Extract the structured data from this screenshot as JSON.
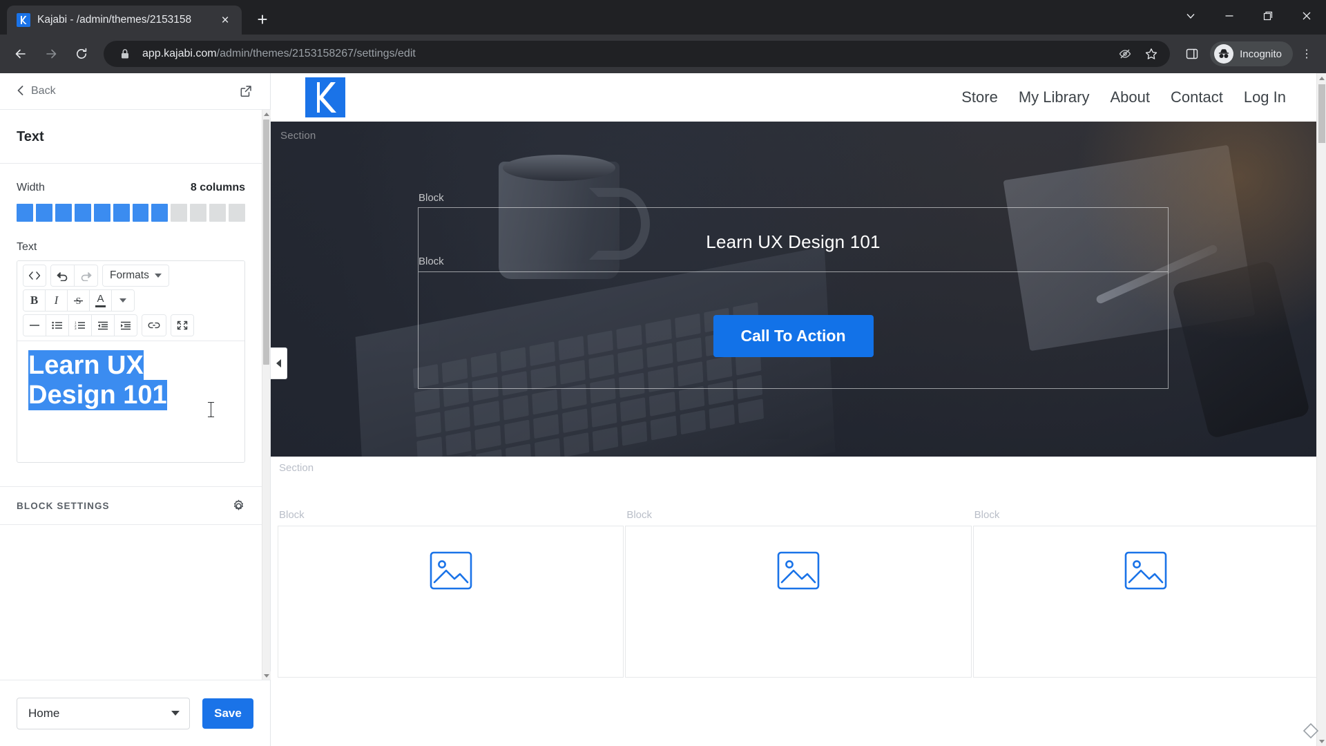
{
  "browser": {
    "tab": {
      "title": "Kajabi - /admin/themes/2153158",
      "favicon_name": "kajabi-favicon",
      "close_label": "×"
    },
    "new_tab_label": "+",
    "window_controls": {
      "chevron_label": "⌄",
      "minimize_label": "—",
      "restore_label": "❐",
      "close_label": "✕"
    },
    "nav": {
      "back_label": "←",
      "forward_label": "→",
      "reload_label": "↻"
    },
    "address": {
      "lock_icon": "lock-icon",
      "domain": "app.kajabi.com",
      "path": "/admin/themes/2153158267/settings/edit",
      "full_url": "app.kajabi.com/admin/themes/2153158267/settings/edit"
    },
    "actions": {
      "tracking_label": "tracking-protection-icon",
      "bookmark_label": "star-icon",
      "sidepanel_label": "side-panel-icon",
      "profile_label": "Incognito",
      "menu_label": "⋮"
    }
  },
  "sidebar": {
    "back_label": "Back",
    "open_external_label": "open-in-new-icon",
    "panel_title": "Text",
    "width": {
      "label": "Width",
      "value_label": "8 columns",
      "filled_columns": 8,
      "total_columns": 12
    },
    "text_field": {
      "label": "Text",
      "content_lines": [
        "Learn UX",
        "Design 101"
      ],
      "content_plain": "Learn UX Design 101",
      "selection_color": "#3b8cf0"
    },
    "toolbar": {
      "row1": [
        {
          "name": "source-code-icon",
          "label": "< >"
        },
        {
          "name": "undo-icon",
          "label": "↶"
        },
        {
          "name": "redo-icon",
          "label": "↷"
        },
        {
          "name": "formats-dropdown",
          "label": "Formats"
        }
      ],
      "row2": [
        {
          "name": "bold-button",
          "label": "B"
        },
        {
          "name": "italic-button",
          "label": "I"
        },
        {
          "name": "strikethrough-button",
          "label": "S"
        },
        {
          "name": "font-color-button",
          "label": "A"
        }
      ],
      "row3": [
        {
          "name": "horizontal-rule-button",
          "label": "—"
        },
        {
          "name": "bullet-list-button",
          "label": "bullet-list-icon"
        },
        {
          "name": "numbered-list-button",
          "label": "numbered-list-icon"
        },
        {
          "name": "outdent-button",
          "label": "outdent-icon"
        },
        {
          "name": "indent-button",
          "label": "indent-icon"
        },
        {
          "name": "insert-link-button",
          "label": "link-icon"
        },
        {
          "name": "fullscreen-button",
          "label": "fullscreen-icon"
        }
      ]
    },
    "block_settings": {
      "label": "BLOCK SETTINGS",
      "gear_label": "gear-icon"
    },
    "footer": {
      "page_select_value": "Home",
      "save_label": "Save",
      "save_color": "#1a73e8"
    }
  },
  "preview": {
    "site_nav": {
      "logo_label": "kajabi-logo",
      "links": [
        "Store",
        "My Library",
        "About",
        "Contact",
        "Log In"
      ]
    },
    "hero": {
      "section_tag": "Section",
      "block_tag_top": "Block",
      "block_tag_bottom": "Block",
      "heading": "Learn UX Design 101",
      "cta_label": "Call To Action",
      "cta_color": "#1272e8"
    },
    "section2": {
      "section_tag": "Section",
      "blocks": [
        {
          "tag": "Block",
          "icon": "image-placeholder-icon"
        },
        {
          "tag": "Block",
          "icon": "image-placeholder-icon"
        },
        {
          "tag": "Block",
          "icon": "image-placeholder-icon"
        }
      ]
    },
    "collapse_handle_label": "collapse-panel-icon"
  }
}
